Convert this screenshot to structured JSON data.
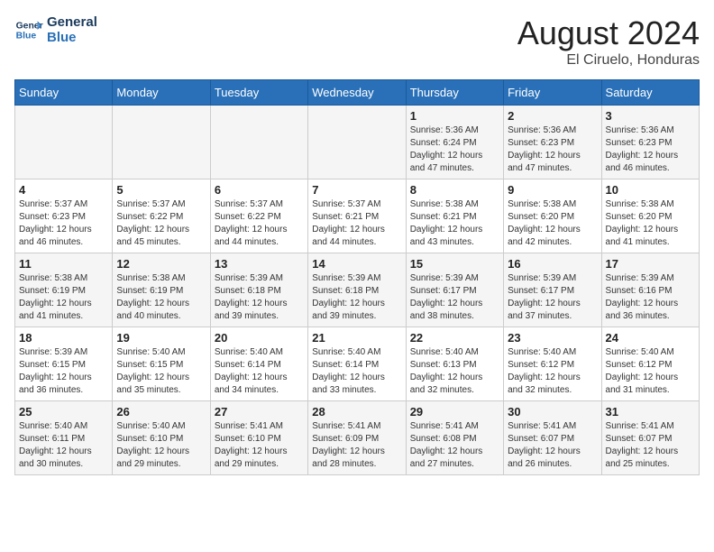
{
  "logo": {
    "line1": "General",
    "line2": "Blue"
  },
  "title": "August 2024",
  "location": "El Ciruelo, Honduras",
  "days_of_week": [
    "Sunday",
    "Monday",
    "Tuesday",
    "Wednesday",
    "Thursday",
    "Friday",
    "Saturday"
  ],
  "weeks": [
    [
      {
        "day": "",
        "info": ""
      },
      {
        "day": "",
        "info": ""
      },
      {
        "day": "",
        "info": ""
      },
      {
        "day": "",
        "info": ""
      },
      {
        "day": "1",
        "info": "Sunrise: 5:36 AM\nSunset: 6:24 PM\nDaylight: 12 hours\nand 47 minutes."
      },
      {
        "day": "2",
        "info": "Sunrise: 5:36 AM\nSunset: 6:23 PM\nDaylight: 12 hours\nand 47 minutes."
      },
      {
        "day": "3",
        "info": "Sunrise: 5:36 AM\nSunset: 6:23 PM\nDaylight: 12 hours\nand 46 minutes."
      }
    ],
    [
      {
        "day": "4",
        "info": "Sunrise: 5:37 AM\nSunset: 6:23 PM\nDaylight: 12 hours\nand 46 minutes."
      },
      {
        "day": "5",
        "info": "Sunrise: 5:37 AM\nSunset: 6:22 PM\nDaylight: 12 hours\nand 45 minutes."
      },
      {
        "day": "6",
        "info": "Sunrise: 5:37 AM\nSunset: 6:22 PM\nDaylight: 12 hours\nand 44 minutes."
      },
      {
        "day": "7",
        "info": "Sunrise: 5:37 AM\nSunset: 6:21 PM\nDaylight: 12 hours\nand 44 minutes."
      },
      {
        "day": "8",
        "info": "Sunrise: 5:38 AM\nSunset: 6:21 PM\nDaylight: 12 hours\nand 43 minutes."
      },
      {
        "day": "9",
        "info": "Sunrise: 5:38 AM\nSunset: 6:20 PM\nDaylight: 12 hours\nand 42 minutes."
      },
      {
        "day": "10",
        "info": "Sunrise: 5:38 AM\nSunset: 6:20 PM\nDaylight: 12 hours\nand 41 minutes."
      }
    ],
    [
      {
        "day": "11",
        "info": "Sunrise: 5:38 AM\nSunset: 6:19 PM\nDaylight: 12 hours\nand 41 minutes."
      },
      {
        "day": "12",
        "info": "Sunrise: 5:38 AM\nSunset: 6:19 PM\nDaylight: 12 hours\nand 40 minutes."
      },
      {
        "day": "13",
        "info": "Sunrise: 5:39 AM\nSunset: 6:18 PM\nDaylight: 12 hours\nand 39 minutes."
      },
      {
        "day": "14",
        "info": "Sunrise: 5:39 AM\nSunset: 6:18 PM\nDaylight: 12 hours\nand 39 minutes."
      },
      {
        "day": "15",
        "info": "Sunrise: 5:39 AM\nSunset: 6:17 PM\nDaylight: 12 hours\nand 38 minutes."
      },
      {
        "day": "16",
        "info": "Sunrise: 5:39 AM\nSunset: 6:17 PM\nDaylight: 12 hours\nand 37 minutes."
      },
      {
        "day": "17",
        "info": "Sunrise: 5:39 AM\nSunset: 6:16 PM\nDaylight: 12 hours\nand 36 minutes."
      }
    ],
    [
      {
        "day": "18",
        "info": "Sunrise: 5:39 AM\nSunset: 6:15 PM\nDaylight: 12 hours\nand 36 minutes."
      },
      {
        "day": "19",
        "info": "Sunrise: 5:40 AM\nSunset: 6:15 PM\nDaylight: 12 hours\nand 35 minutes."
      },
      {
        "day": "20",
        "info": "Sunrise: 5:40 AM\nSunset: 6:14 PM\nDaylight: 12 hours\nand 34 minutes."
      },
      {
        "day": "21",
        "info": "Sunrise: 5:40 AM\nSunset: 6:14 PM\nDaylight: 12 hours\nand 33 minutes."
      },
      {
        "day": "22",
        "info": "Sunrise: 5:40 AM\nSunset: 6:13 PM\nDaylight: 12 hours\nand 32 minutes."
      },
      {
        "day": "23",
        "info": "Sunrise: 5:40 AM\nSunset: 6:12 PM\nDaylight: 12 hours\nand 32 minutes."
      },
      {
        "day": "24",
        "info": "Sunrise: 5:40 AM\nSunset: 6:12 PM\nDaylight: 12 hours\nand 31 minutes."
      }
    ],
    [
      {
        "day": "25",
        "info": "Sunrise: 5:40 AM\nSunset: 6:11 PM\nDaylight: 12 hours\nand 30 minutes."
      },
      {
        "day": "26",
        "info": "Sunrise: 5:40 AM\nSunset: 6:10 PM\nDaylight: 12 hours\nand 29 minutes."
      },
      {
        "day": "27",
        "info": "Sunrise: 5:41 AM\nSunset: 6:10 PM\nDaylight: 12 hours\nand 29 minutes."
      },
      {
        "day": "28",
        "info": "Sunrise: 5:41 AM\nSunset: 6:09 PM\nDaylight: 12 hours\nand 28 minutes."
      },
      {
        "day": "29",
        "info": "Sunrise: 5:41 AM\nSunset: 6:08 PM\nDaylight: 12 hours\nand 27 minutes."
      },
      {
        "day": "30",
        "info": "Sunrise: 5:41 AM\nSunset: 6:07 PM\nDaylight: 12 hours\nand 26 minutes."
      },
      {
        "day": "31",
        "info": "Sunrise: 5:41 AM\nSunset: 6:07 PM\nDaylight: 12 hours\nand 25 minutes."
      }
    ]
  ]
}
